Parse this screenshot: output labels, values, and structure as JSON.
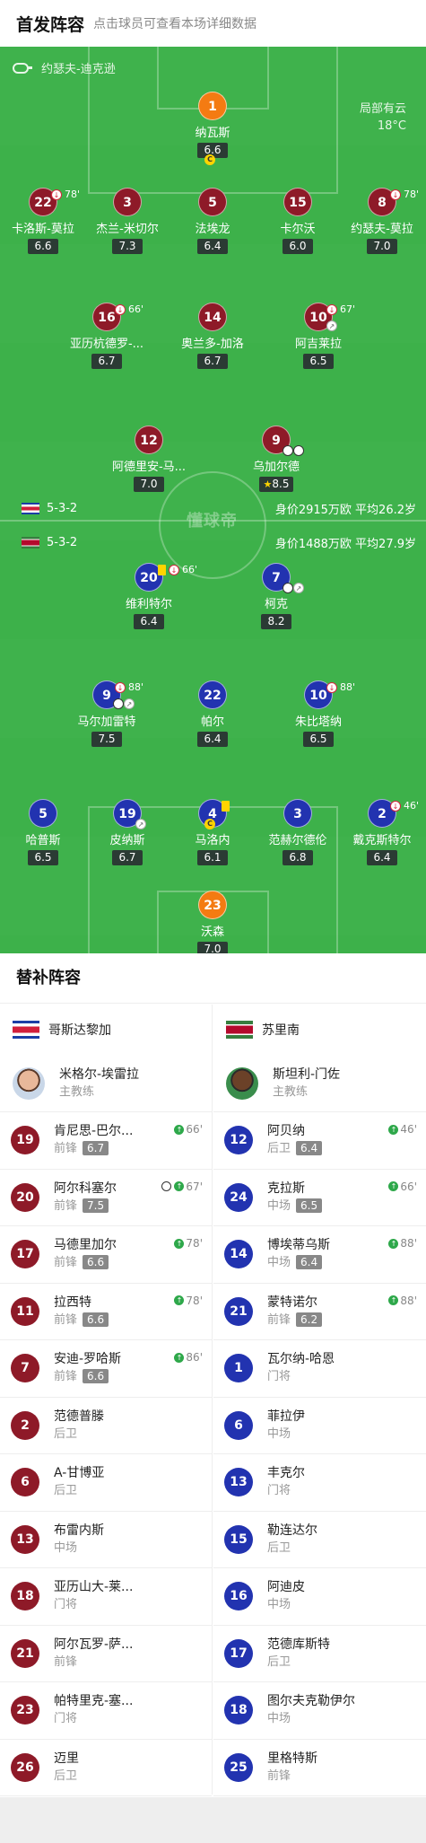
{
  "header": {
    "title": "首发阵容",
    "hint": "点击球员可查看本场详细数据"
  },
  "pitch": {
    "referee": "约瑟夫-迪克逊",
    "weather": "局部有云",
    "temperature": "18°C",
    "watermark": "懂球帝",
    "home_bar": {
      "formation": "5-3-2",
      "stats": "身价2915万欧 平均26.2岁"
    },
    "away_bar": {
      "formation": "5-3-2",
      "stats": "身价1488万欧 平均27.9岁"
    },
    "home_players": [
      {
        "num": "1",
        "name": "纳瓦斯",
        "rating": "6.6",
        "captain": true
      },
      {
        "num": "22",
        "name": "卡洛斯-莫拉",
        "rating": "6.6",
        "sub": "78'"
      },
      {
        "num": "3",
        "name": "杰兰-米切尔",
        "rating": "7.3"
      },
      {
        "num": "5",
        "name": "法埃龙",
        "rating": "6.4"
      },
      {
        "num": "15",
        "name": "卡尔沃",
        "rating": "6.0"
      },
      {
        "num": "8",
        "name": "约瑟夫-莫拉",
        "rating": "7.0",
        "sub": "78'"
      },
      {
        "num": "16",
        "name": "亚历杭德罗-...",
        "rating": "6.7",
        "sub": "66'"
      },
      {
        "num": "14",
        "name": "奥兰多-加洛",
        "rating": "6.7"
      },
      {
        "num": "10",
        "name": "阿吉莱拉",
        "rating": "6.5",
        "sub": "67'"
      },
      {
        "num": "12",
        "name": "阿德里安-马...",
        "rating": "7.0"
      },
      {
        "num": "9",
        "name": "乌加尔德",
        "rating": "8.5"
      }
    ],
    "away_players": [
      {
        "num": "20",
        "name": "维利特尔",
        "rating": "6.4",
        "sub": "66'"
      },
      {
        "num": "7",
        "name": "柯克",
        "rating": "8.2"
      },
      {
        "num": "9",
        "name": "马尔加雷特",
        "rating": "7.5",
        "sub": "88'"
      },
      {
        "num": "22",
        "name": "帕尔",
        "rating": "6.4"
      },
      {
        "num": "10",
        "name": "朱比塔纳",
        "rating": "6.5",
        "sub": "88'"
      },
      {
        "num": "5",
        "name": "哈普斯",
        "rating": "6.5"
      },
      {
        "num": "19",
        "name": "皮纳斯",
        "rating": "6.7"
      },
      {
        "num": "4",
        "name": "马洛内",
        "rating": "6.1"
      },
      {
        "num": "3",
        "name": "范赫尔德伦",
        "rating": "6.8"
      },
      {
        "num": "2",
        "name": "戴克斯特尔",
        "rating": "6.4",
        "sub": "46'"
      },
      {
        "num": "23",
        "name": "沃森",
        "rating": "7.0"
      }
    ]
  },
  "subs": {
    "title": "替补阵容",
    "home": {
      "team": "哥斯达黎加",
      "coach": {
        "name": "米格尔-埃雷拉",
        "role": "主教练"
      },
      "players": [
        {
          "num": "19",
          "name": "肯尼思-巴尔...",
          "pos": "前锋",
          "rating": "6.7",
          "time": "66'"
        },
        {
          "num": "20",
          "name": "阿尔科塞尔",
          "pos": "前锋",
          "rating": "7.5",
          "time": "67'",
          "goal": true
        },
        {
          "num": "17",
          "name": "马德里加尔",
          "pos": "前锋",
          "rating": "6.6",
          "time": "78'"
        },
        {
          "num": "11",
          "name": "拉西特",
          "pos": "前锋",
          "rating": "6.6",
          "time": "78'"
        },
        {
          "num": "7",
          "name": "安迪-罗哈斯",
          "pos": "前锋",
          "rating": "6.6",
          "time": "86'"
        },
        {
          "num": "2",
          "name": "范德普滕",
          "pos": "后卫"
        },
        {
          "num": "6",
          "name": "A-甘博亚",
          "pos": "后卫"
        },
        {
          "num": "13",
          "name": "布雷内斯",
          "pos": "中场"
        },
        {
          "num": "18",
          "name": "亚历山大-莱...",
          "pos": "门将"
        },
        {
          "num": "21",
          "name": "阿尔瓦罗-萨...",
          "pos": "前锋"
        },
        {
          "num": "23",
          "name": "帕特里克-塞...",
          "pos": "门将"
        },
        {
          "num": "26",
          "name": "迈里",
          "pos": "后卫"
        }
      ]
    },
    "away": {
      "team": "苏里南",
      "coach": {
        "name": "斯坦利-门佐",
        "role": "主教练"
      },
      "players": [
        {
          "num": "12",
          "name": "阿贝纳",
          "pos": "后卫",
          "rating": "6.4",
          "time": "46'"
        },
        {
          "num": "24",
          "name": "克拉斯",
          "pos": "中场",
          "rating": "6.5",
          "time": "66'"
        },
        {
          "num": "14",
          "name": "博埃蒂乌斯",
          "pos": "中场",
          "rating": "6.4",
          "time": "88'"
        },
        {
          "num": "21",
          "name": "蒙特诺尔",
          "pos": "前锋",
          "rating": "6.2",
          "time": "88'"
        },
        {
          "num": "1",
          "name": "瓦尔纳-哈恩",
          "pos": "门将"
        },
        {
          "num": "6",
          "name": "菲拉伊",
          "pos": "中场"
        },
        {
          "num": "13",
          "name": "丰克尔",
          "pos": "门将"
        },
        {
          "num": "15",
          "name": "勒连达尔",
          "pos": "后卫"
        },
        {
          "num": "16",
          "name": "阿迪皮",
          "pos": "中场"
        },
        {
          "num": "17",
          "name": "范德库斯特",
          "pos": "后卫"
        },
        {
          "num": "18",
          "name": "图尔夫克勒伊尔",
          "pos": "中场"
        },
        {
          "num": "25",
          "name": "里格特斯",
          "pos": "前锋"
        }
      ]
    }
  },
  "colors": {
    "home": "#8e1a28",
    "away": "#2233b0",
    "goalkeeper": "#f47b12",
    "pitch": "#3db14a"
  }
}
